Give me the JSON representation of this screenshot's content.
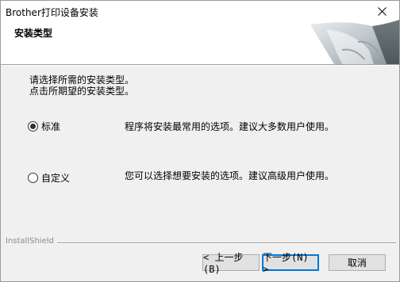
{
  "window": {
    "title": "Brother打印设备安装"
  },
  "header": {
    "title": "安装类型"
  },
  "instructions": {
    "line1": "请选择所需的安装类型。",
    "line2": "点击所期望的安装类型。"
  },
  "options": [
    {
      "label": "标准",
      "description": "程序将安装最常用的选项。建议大多数用户使用。",
      "selected": true
    },
    {
      "label": "自定义",
      "description": "您可以选择想要安装的选项。建议高级用户使用。",
      "selected": false
    }
  ],
  "footer": {
    "brand": "InstallShield"
  },
  "buttons": {
    "back": "< 上一步(B)",
    "next": "下一步(N) >",
    "cancel": "取消"
  }
}
